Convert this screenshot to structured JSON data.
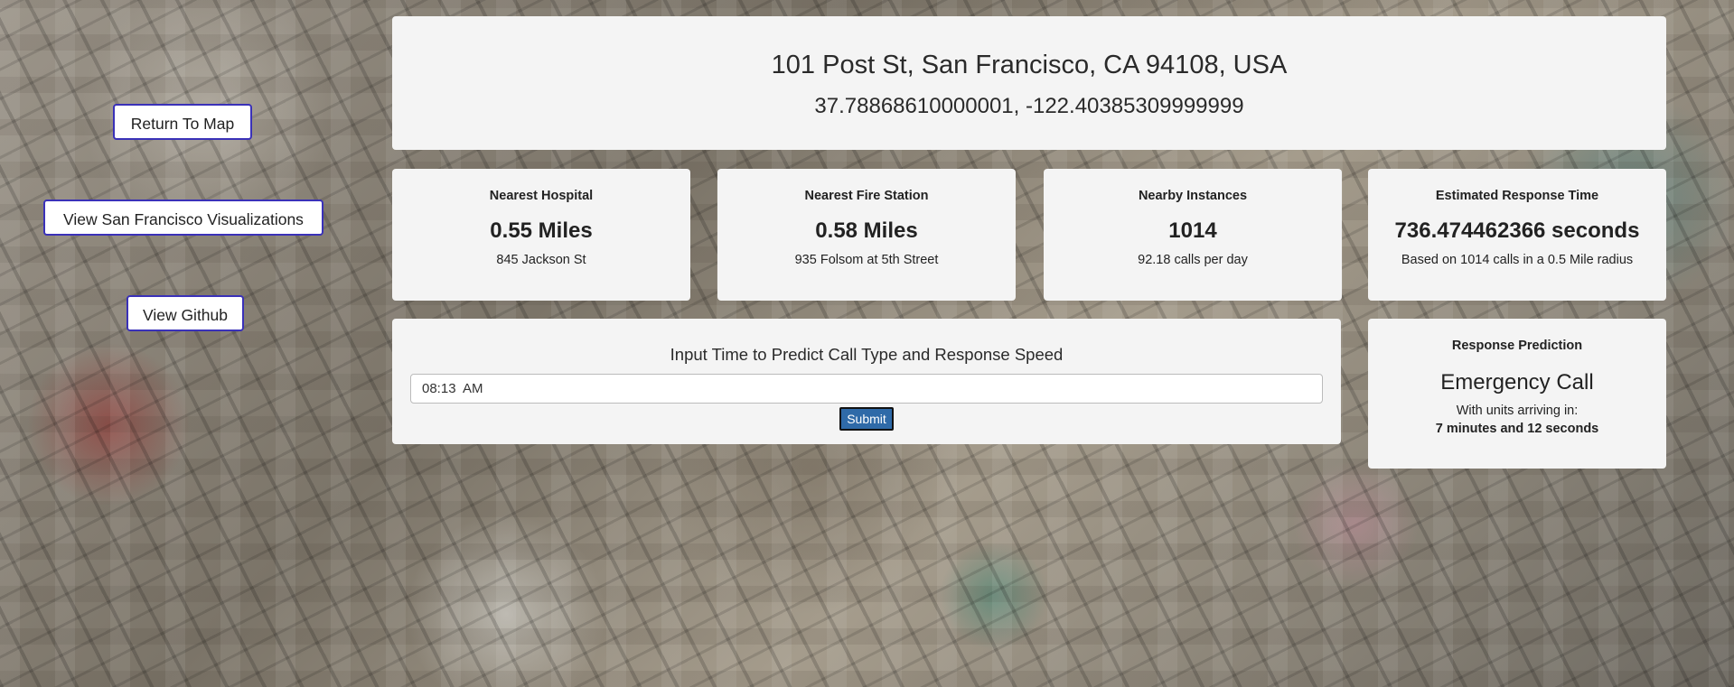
{
  "nav": {
    "return_to_map": "Return To Map",
    "view_visualizations": "View San Francisco Visualizations",
    "view_github": "View Github"
  },
  "location": {
    "address": "101 Post St, San Francisco, CA 94108, USA",
    "coordinates": "37.78868610000001, -122.40385309999999"
  },
  "stats": {
    "hospital": {
      "label": "Nearest Hospital",
      "value": "0.55 Miles",
      "detail": "845 Jackson St"
    },
    "fire_station": {
      "label": "Nearest Fire Station",
      "value": "0.58 Miles",
      "detail": "935 Folsom at 5th Street"
    },
    "instances": {
      "label": "Nearby Instances",
      "value": "1014",
      "detail": "92.18 calls per day"
    },
    "response": {
      "label": "Estimated Response Time",
      "value": "736.474462366 seconds",
      "detail": "Based on 1014 calls in a 0.5 Mile radius"
    }
  },
  "predict": {
    "title": "Input Time to Predict Call Type and Response Speed",
    "time_value": "08:13  AM",
    "submit_label": "Submit"
  },
  "prediction": {
    "label": "Response Prediction",
    "call_type": "Emergency Call",
    "arrival_label": "With units arriving in:",
    "arrival_time": "7 minutes and 12 seconds"
  }
}
